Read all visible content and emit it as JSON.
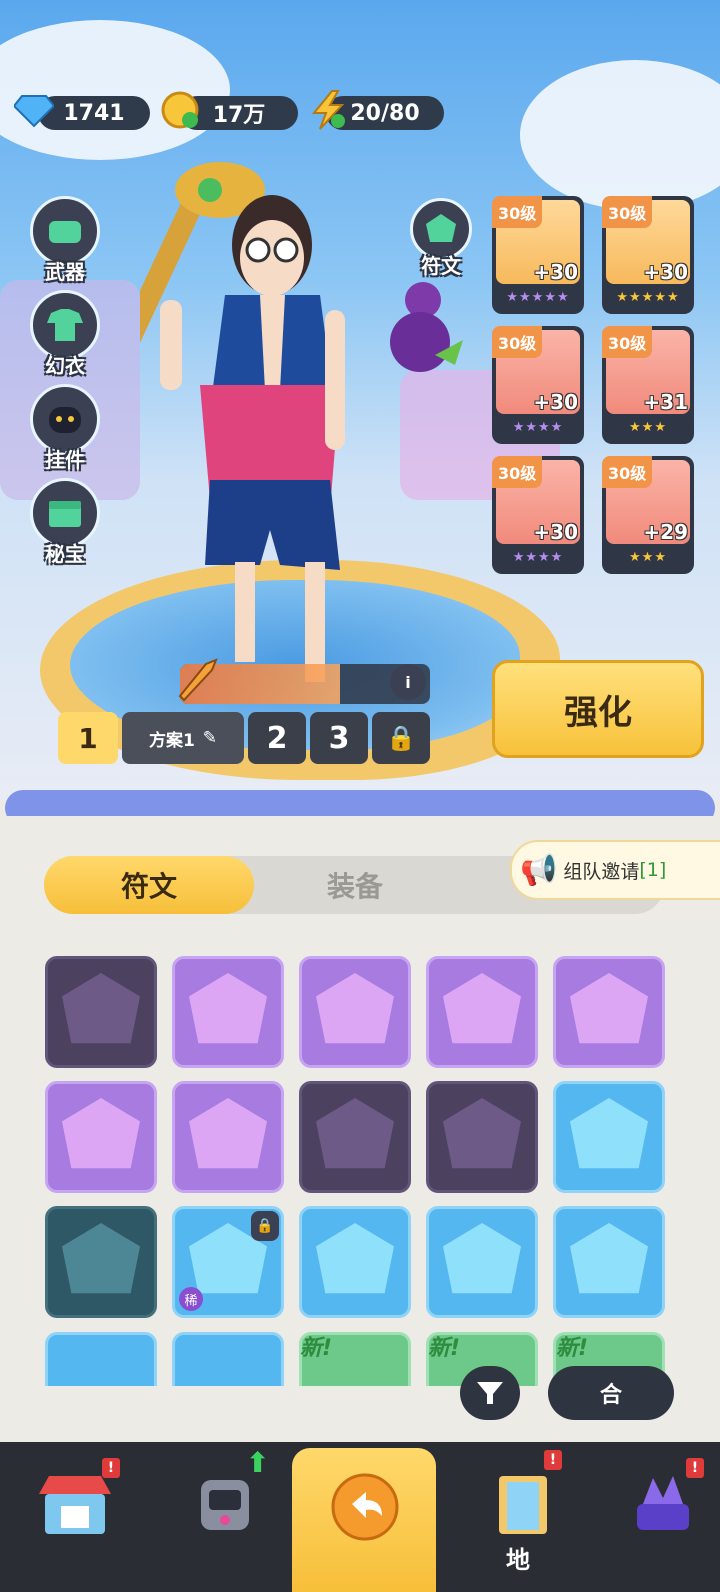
{
  "currency": {
    "diamond": "1741",
    "gold": "17万",
    "energy": "20/80"
  },
  "left_menu": [
    {
      "label": "武器",
      "icon": "weapon-icon"
    },
    {
      "label": "幻衣",
      "icon": "costume-icon"
    },
    {
      "label": "挂件",
      "icon": "pendant-icon"
    },
    {
      "label": "秘宝",
      "icon": "treasure-icon"
    }
  ],
  "rune_button": {
    "label": "符文",
    "icon": "rune-icon"
  },
  "equipment": [
    {
      "level": "30级",
      "plus": "+30",
      "stars": "★★★★★",
      "icon": "helmet-icon"
    },
    {
      "level": "30级",
      "plus": "+30",
      "stars": "★★★★★",
      "icon": "armor-icon"
    },
    {
      "level": "30级",
      "plus": "+30",
      "stars": "★★★★",
      "icon": "bracer-icon"
    },
    {
      "level": "30级",
      "plus": "+31",
      "stars": "★★★",
      "icon": "pants-icon"
    },
    {
      "level": "30级",
      "plus": "+30",
      "stars": "★★★★",
      "icon": "boots-icon"
    },
    {
      "level": "30级",
      "plus": "+29",
      "stars": "★★★",
      "icon": "eye-orb-icon"
    }
  ],
  "strengthen_label": "强化",
  "plans": {
    "active": "1",
    "name": "方案1",
    "p2": "2",
    "p3": "3"
  },
  "tabs": {
    "rune": "符文",
    "equip": "装备"
  },
  "invite": {
    "text": "组队邀请",
    "count": "[1]"
  },
  "rare_tag": "稀",
  "new_tag": "新!",
  "merge_label": "合",
  "nav": {
    "map_label": "地"
  },
  "badge_mark": "!",
  "colors": {
    "purple": "#a77be0",
    "blue": "#55b7f0",
    "dark_purple": "#4d4160",
    "dark_teal": "#2f5866",
    "gold": "#f8c23a"
  }
}
